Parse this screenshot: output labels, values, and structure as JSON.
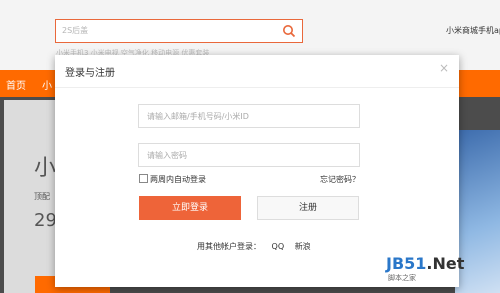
{
  "background": {
    "search_placeholder": "2S后盖",
    "hot_words": "小米手机3  小米电视  空气净化  移动电源  优惠套装",
    "header_right": "小米商城手机app",
    "nav": [
      "首页",
      "小"
    ],
    "promo_title": "小",
    "promo_sub": "顶配",
    "promo_price": "29",
    "accent_color": "#ff6a00"
  },
  "modal": {
    "title": "登录与注册",
    "close_icon": "close-icon",
    "account_placeholder": "请输入邮箱/手机号码/小米ID",
    "password_placeholder": "请输入密码",
    "remember_label": "两周内自动登录",
    "forgot_label": "忘记密码？",
    "login_button": "立即登录",
    "register_button": "注册",
    "other_login_label": "用其他帐户登录：",
    "other_login_qq": "QQ",
    "other_login_weibo": "新浪",
    "login_button_color": "#ee6439"
  },
  "watermark": {
    "brand_a": "JB51",
    "brand_b": ".Net",
    "sub": "脚本之家"
  }
}
